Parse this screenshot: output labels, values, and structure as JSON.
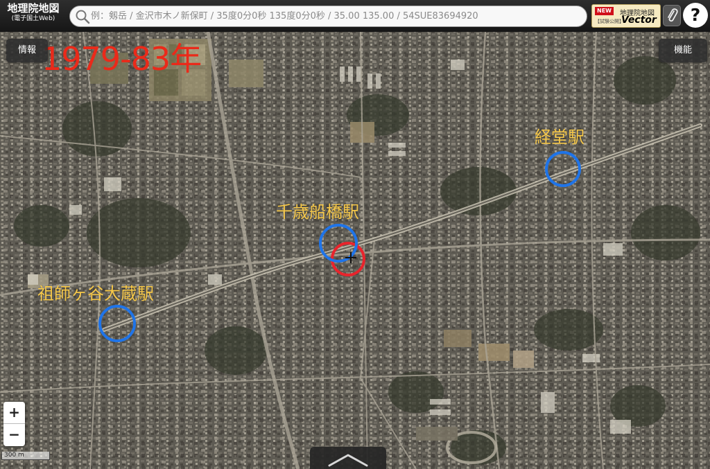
{
  "header": {
    "logo_title": "地理院地図",
    "logo_subtitle": "(電子国土Web)",
    "search_placeholder": "例：剱岳 / 金沢市木ノ新保町 / 35度0分0秒 135度0分0秒 / 35.00 135.00 / 54SUE83694920",
    "vector_badge": {
      "new_label": "NEW",
      "name": "地理院地図",
      "sub": "【試験公開】",
      "vector": "Vector"
    },
    "help_label": "?"
  },
  "map": {
    "info_button": "情報",
    "function_button": "機能",
    "year_label": "1979-83年",
    "stations": {
      "kyodo": "経堂駅",
      "chitose_funabashi": "千歳船橋駅",
      "soshigaya_okura": "祖師ヶ谷大蔵駅"
    },
    "zoom_in": "+",
    "zoom_out": "−",
    "scale_label": "300 m",
    "colors": {
      "year_label": "#ea2a1a",
      "station_label": "#f6c84a",
      "station_circle": "#1f74e8",
      "highlight_circle": "#e8242c"
    }
  }
}
